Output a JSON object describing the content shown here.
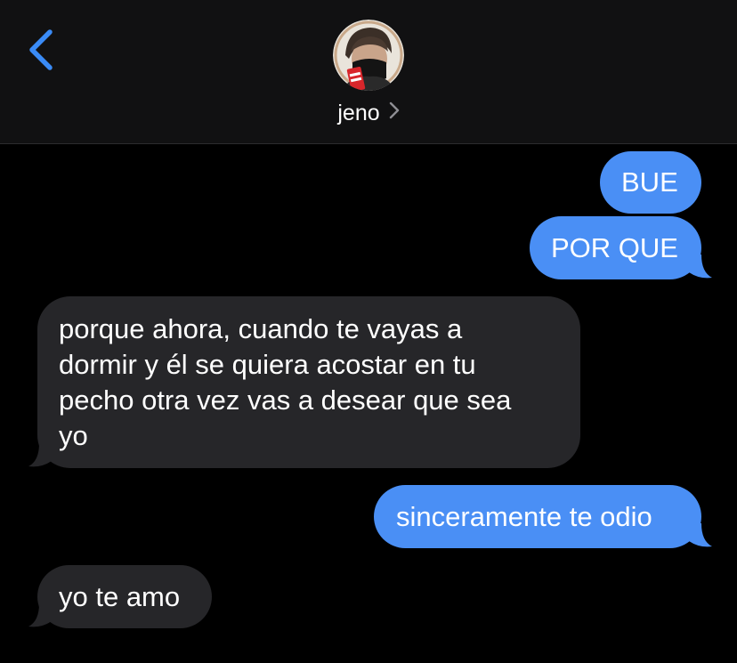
{
  "header": {
    "back_icon": "chevron-left-icon",
    "contact_name": "jeno",
    "contact_chevron_icon": "chevron-right-icon",
    "accent_color": "#3a8bf6"
  },
  "messages": [
    {
      "direction": "sent",
      "text": "BUE"
    },
    {
      "direction": "sent",
      "text": "POR QUE"
    },
    {
      "direction": "received",
      "lines": [
        "porque ahora, cuando te vayas a",
        "dormir y él se quiera acostar en tu",
        "pecho otra vez vas a desear que sea",
        "yo"
      ]
    },
    {
      "direction": "sent",
      "text": "sinceramente te odio"
    },
    {
      "direction": "received",
      "text": "yo te amo"
    }
  ],
  "colors": {
    "sent_bubble": "#4a8ff5",
    "received_bubble": "#262629",
    "background": "#000000",
    "header_background": "#111112"
  }
}
